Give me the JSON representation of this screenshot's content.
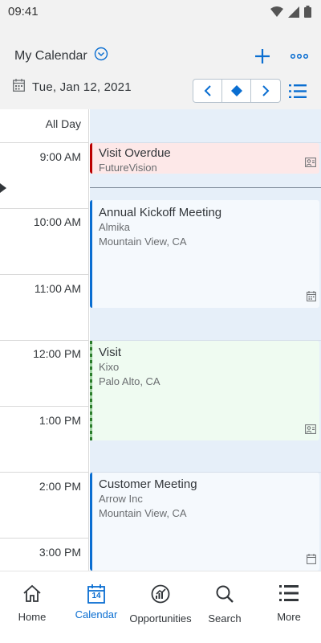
{
  "status_bar": {
    "time": "09:41"
  },
  "header": {
    "title": "My Calendar",
    "date": "Tue, Jan 12,  2021"
  },
  "calendar": {
    "all_day_label": "All Day",
    "hours": [
      "9:00 AM",
      "10:00 AM",
      "11:00 AM",
      "12:00 PM",
      "1:00 PM",
      "2:00 PM",
      "3:00 PM"
    ],
    "events": [
      {
        "title": "Visit Overdue",
        "line1": "FutureVision",
        "line2": ""
      },
      {
        "title": "Annual Kickoff Meeting",
        "line1": "Almika",
        "line2": "Mountain View, CA"
      },
      {
        "title": "Visit",
        "line1": "Kixo",
        "line2": "Palo Alto, CA"
      },
      {
        "title": "Customer Meeting",
        "line1": "Arrow Inc",
        "line2": "Mountain View, CA"
      }
    ]
  },
  "bottom_nav": {
    "items": [
      {
        "label": "Home"
      },
      {
        "label": "Calendar",
        "badge": "14"
      },
      {
        "label": "Opportunities"
      },
      {
        "label": "Search"
      },
      {
        "label": "More"
      }
    ],
    "active": "Calendar"
  },
  "colors": {
    "accent": "#0a6ed1",
    "overdue": "#bb0000",
    "visit": "#2b7d2b",
    "event_bg": "#e6eff9"
  }
}
